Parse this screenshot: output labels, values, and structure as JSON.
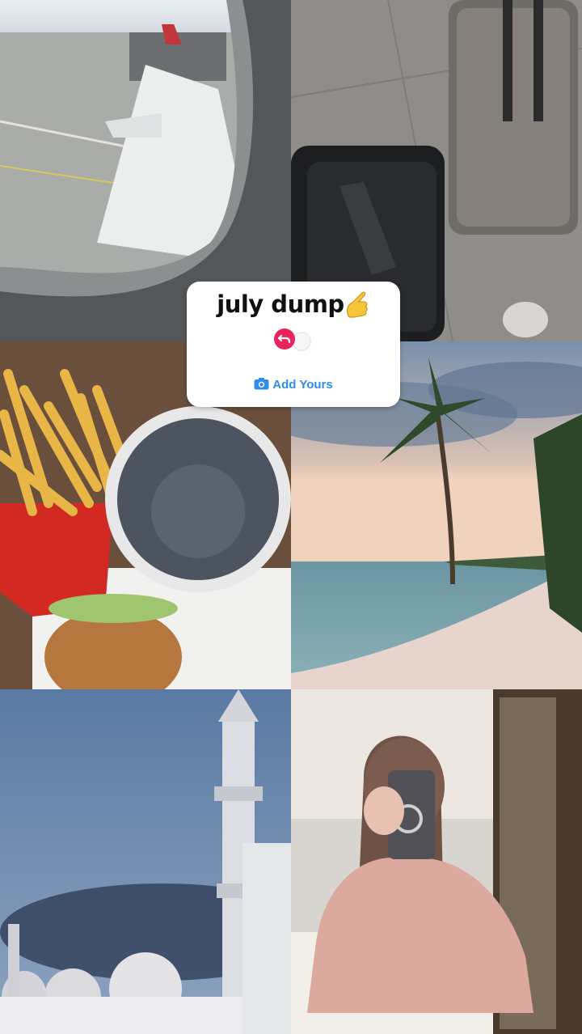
{
  "sticker": {
    "title": "july dump",
    "emoji_icon": "pointing-hand-icon",
    "action_label": "Add Yours",
    "action_icon": "camera-icon",
    "accent_color": "#2f8ee8",
    "avatar_color": "#e8245c"
  },
  "tiles": [
    {
      "id": "airplane-window-photo"
    },
    {
      "id": "luggage-photo"
    },
    {
      "id": "fast-food-photo"
    },
    {
      "id": "beach-palm-photo"
    },
    {
      "id": "mosque-photo"
    },
    {
      "id": "mirror-selfie-photo"
    }
  ]
}
